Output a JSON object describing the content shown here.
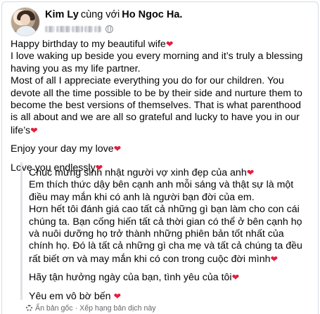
{
  "post": {
    "author": "Kim Ly",
    "with_text": "cùng với",
    "tagged": "Ho Ngoc Ha.",
    "heart_icon": "red-heart",
    "paragraphs": [
      {
        "text": "Happy birthday to my beautiful wife",
        "heart": true
      },
      {
        "text": "I love waking up beside you every morning and it’s truly a blessing having you as my life partner.",
        "heart": false
      },
      {
        "text": "Most of all I appreciate everything you do for our children. You devote all the time possible to be by their side and nurture them to become the best versions of themselves. That is what parenthood is all about and we are all so grateful and lucky to have you in our life’s",
        "heart": true
      },
      {
        "text": "Enjoy your day my love",
        "heart": true
      },
      {
        "text": "Love you endlessly",
        "heart": true
      }
    ]
  },
  "translation": {
    "paragraphs": [
      {
        "text": "Chúc mừng sinh nhật người vợ xinh đẹp của anh",
        "heart": true
      },
      {
        "text": "Em thích thức dậy bên cạnh anh mỗi sáng và thật sự là một điều may mắn khi có anh là người bạn đời của em.",
        "heart": false
      },
      {
        "text": "Hơn hết tôi đánh giá cao tất cả những gì bạn làm cho con cái chúng ta. Bạn cống hiến tất cả thời gian có thể ở bên cạnh họ và nuôi dưỡng họ trở thành những phiên bản tốt nhất của chính họ. Đó là tất cả những gì cha mẹ và tất cả chúng ta đều rất biết ơn và may mắn khi có con trong cuộc đời mình",
        "heart": true
      },
      {
        "text": "Hãy tận hưởng ngày của bạn, tình yêu của tôi",
        "heart": true
      },
      {
        "text": "Yêu em vô bờ bến",
        "heart": true
      }
    ],
    "hide_original": "Ẩn bản gốc",
    "separator": "·",
    "rate_translation": "Xếp hạng bản dịch này"
  },
  "colors": {
    "text": "#050505",
    "secondary": "#65676b",
    "heart": "#e41e3f",
    "quote_bar": "#dfe1e6"
  }
}
